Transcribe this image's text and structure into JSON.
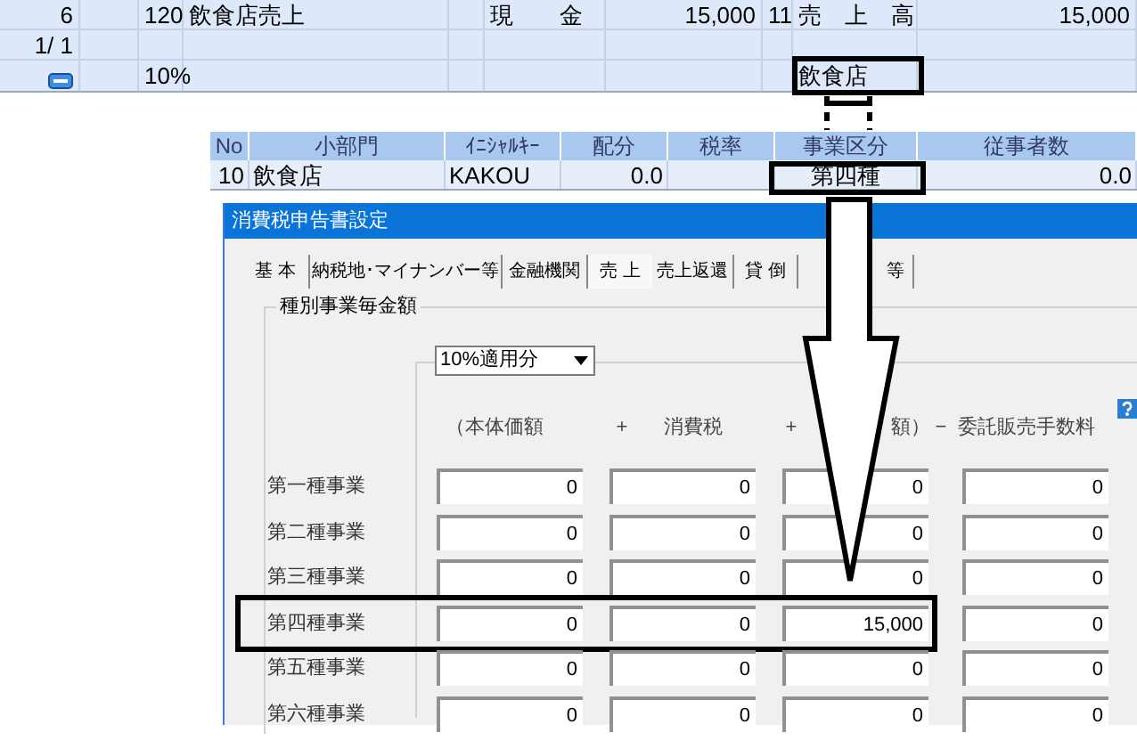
{
  "journal": {
    "rows": [
      {
        "marker": false,
        "cells": [
          "6",
          null,
          "120",
          "飲食店売上",
          null,
          "現　　金",
          "15,000",
          "11",
          "売　上　高",
          "15,000"
        ]
      },
      {
        "marker": false,
        "cells": [
          "1/ 1",
          null,
          null,
          null,
          null,
          null,
          null,
          null,
          null,
          null
        ]
      },
      {
        "marker": true,
        "cells": [
          null,
          null,
          "10%",
          null,
          null,
          null,
          null,
          null,
          "飲食店",
          null
        ]
      }
    ]
  },
  "departments": {
    "columns": [
      "No",
      "小部門",
      "ｲﾆｼｬﾙｷｰ",
      "配分",
      "税率",
      "事業区分",
      "従事者数"
    ],
    "rows": [
      [
        "10",
        "飲食店",
        "KAKOU",
        "0.0",
        null,
        "第四種",
        "0.0"
      ]
    ]
  },
  "dialog": {
    "title": "消費税申告書設定",
    "tabs": [
      {
        "label": "基 本",
        "selected": false
      },
      {
        "label": "納税地･マイナンバー等",
        "selected": false
      },
      {
        "label": "金融機関",
        "selected": false
      },
      {
        "label": "売 上",
        "selected": true
      },
      {
        "label": "売上返還",
        "selected": false
      },
      {
        "label": "貸 倒",
        "selected": false
      },
      {
        "label": "等",
        "selected": false
      }
    ],
    "group_title": "種別事業毎金額",
    "rate_select": "10%適用分",
    "headers": [
      "（本体価額",
      "+",
      "消費税",
      "+",
      "額）",
      "−",
      "委託販売手数料"
    ],
    "rows": [
      {
        "label": "第一種事業",
        "values": [
          "0",
          "0",
          "0",
          "0"
        ],
        "highlighted": false
      },
      {
        "label": "第二種事業",
        "values": [
          "0",
          "0",
          "0",
          "0"
        ],
        "highlighted": false
      },
      {
        "label": "第三種事業",
        "values": [
          "0",
          "0",
          "0",
          "0"
        ],
        "highlighted": false
      },
      {
        "label": "第四種事業",
        "values": [
          "0",
          "0",
          "15,000",
          "0"
        ],
        "highlighted": true
      },
      {
        "label": "第五種事業",
        "values": [
          "0",
          "0",
          "0",
          "0"
        ],
        "highlighted": false
      },
      {
        "label": "第六種事業",
        "values": [
          "0",
          "0",
          "0",
          "0"
        ],
        "highlighted": false
      }
    ]
  }
}
